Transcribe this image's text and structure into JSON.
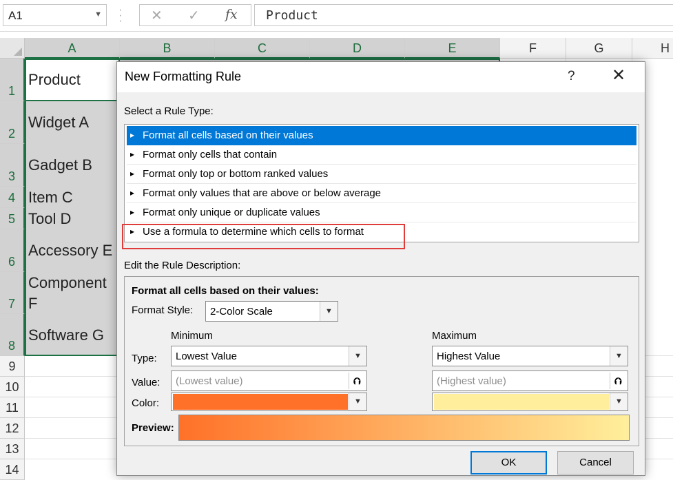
{
  "formula_bar": {
    "name_box": "A1",
    "cancel_icon": "✕",
    "enter_icon": "✓",
    "fx_label": "fx",
    "formula_value": "Product"
  },
  "sheet": {
    "columns": [
      "A",
      "B",
      "C",
      "D",
      "E",
      "F",
      "G",
      "H"
    ],
    "rows": [
      "1",
      "2",
      "3",
      "4",
      "5",
      "6",
      "7",
      "8",
      "9",
      "10",
      "11",
      "12",
      "13",
      "14"
    ],
    "cells": {
      "a1": "Product",
      "a2": "Widget A",
      "a3": "Gadget B",
      "a4": "Item C",
      "a5": "Tool D",
      "a6": "Accessory E",
      "a7_line1": "Component",
      "a7_line2": "F",
      "a8": "Software G"
    }
  },
  "dialog": {
    "title": "New Formatting Rule",
    "help": "?",
    "close": "✕",
    "rule_type_label": "Select a Rule Type:",
    "rule_types": [
      "Format all cells based on their values",
      "Format only cells that contain",
      "Format only top or bottom ranked values",
      "Format only values that are above or below average",
      "Format only unique or duplicate values",
      "Use a formula to determine which cells to format"
    ],
    "rule_arrow": "▸",
    "edit_label": "Edit the Rule Description:",
    "desc_title": "Format all cells based on their values:",
    "format_style_label": "Format Style:",
    "format_style_value": "2-Color Scale",
    "minimum_header": "Minimum",
    "maximum_header": "Maximum",
    "type_label": "Type:",
    "value_label": "Value:",
    "color_label": "Color:",
    "min_type": "Lowest Value",
    "max_type": "Highest Value",
    "min_value_placeholder": "(Lowest value)",
    "max_value_placeholder": "(Highest value)",
    "min_color": "#ff7128",
    "max_color": "#ffef9c",
    "preview_label": "Preview:",
    "ok": "OK",
    "cancel": "Cancel"
  }
}
